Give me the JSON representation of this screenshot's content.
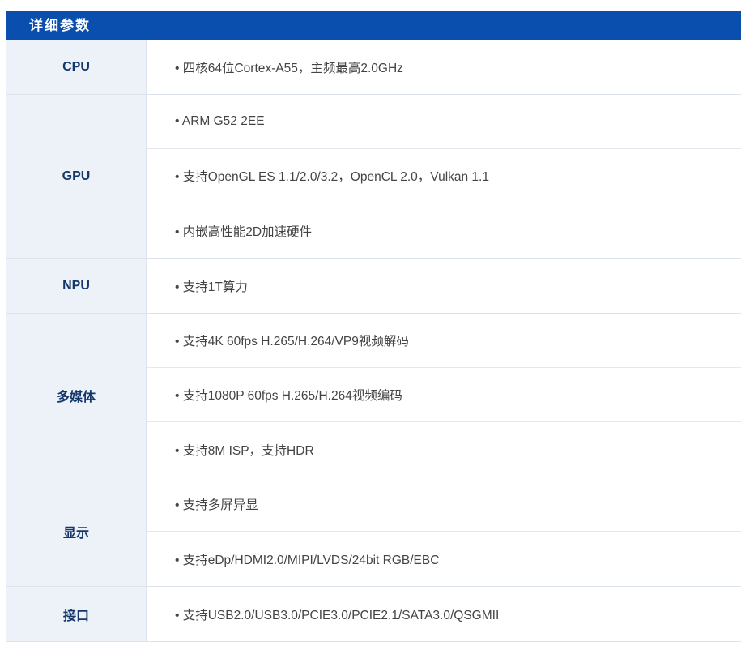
{
  "header": {
    "title": "详细参数"
  },
  "rows": [
    {
      "label": "CPU",
      "values": [
        "• 四核64位Cortex-A55，主频最高2.0GHz"
      ]
    },
    {
      "label": "GPU",
      "values": [
        "• ARM G52 2EE",
        "• 支持OpenGL ES 1.1/2.0/3.2，OpenCL 2.0，Vulkan 1.1",
        "• 内嵌高性能2D加速硬件"
      ]
    },
    {
      "label": "NPU",
      "values": [
        "• 支持1T算力"
      ]
    },
    {
      "label": "多媒体",
      "values": [
        "• 支持4K 60fps H.265/H.264/VP9视频解码",
        "• 支持1080P 60fps H.265/H.264视频编码",
        "• 支持8M ISP，支持HDR"
      ]
    },
    {
      "label": "显示",
      "values": [
        "• 支持多屏异显",
        "• 支持eDp/HDMI2.0/MIPI/LVDS/24bit RGB/EBC"
      ]
    },
    {
      "label": "接口",
      "values": [
        "• 支持USB2.0/USB3.0/PCIE3.0/PCIE2.1/SATA3.0/QSGMII"
      ]
    }
  ]
}
